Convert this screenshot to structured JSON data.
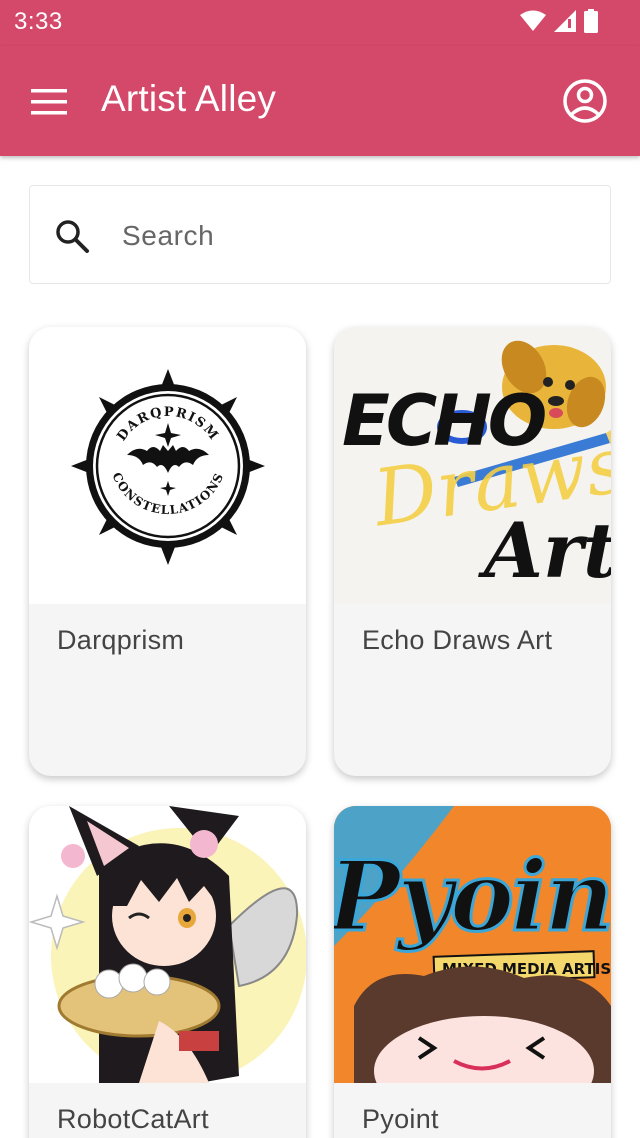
{
  "status_bar": {
    "time": "3:33",
    "icons": [
      "wifi-icon",
      "signal-icon",
      "battery-icon"
    ]
  },
  "app_bar": {
    "title": "Artist Alley",
    "menu_icon": "menu-icon",
    "account_icon": "account-circle-icon",
    "color": "#d4486a"
  },
  "search": {
    "placeholder": "Search",
    "value": ""
  },
  "artists": [
    {
      "name": "Darqprism",
      "logo_text_top": "DARQPRISM",
      "logo_text_bottom": "CONSTELLATIONS"
    },
    {
      "name": "Echo Draws Art",
      "logo_line1": "ECHO",
      "logo_line2": "Draws",
      "logo_line3": "Art"
    },
    {
      "name": "RobotCatArt"
    },
    {
      "name": "Pyoint",
      "logo_text": "Pyoint",
      "logo_tag": "MIXED MEDIA ARTIST"
    }
  ]
}
